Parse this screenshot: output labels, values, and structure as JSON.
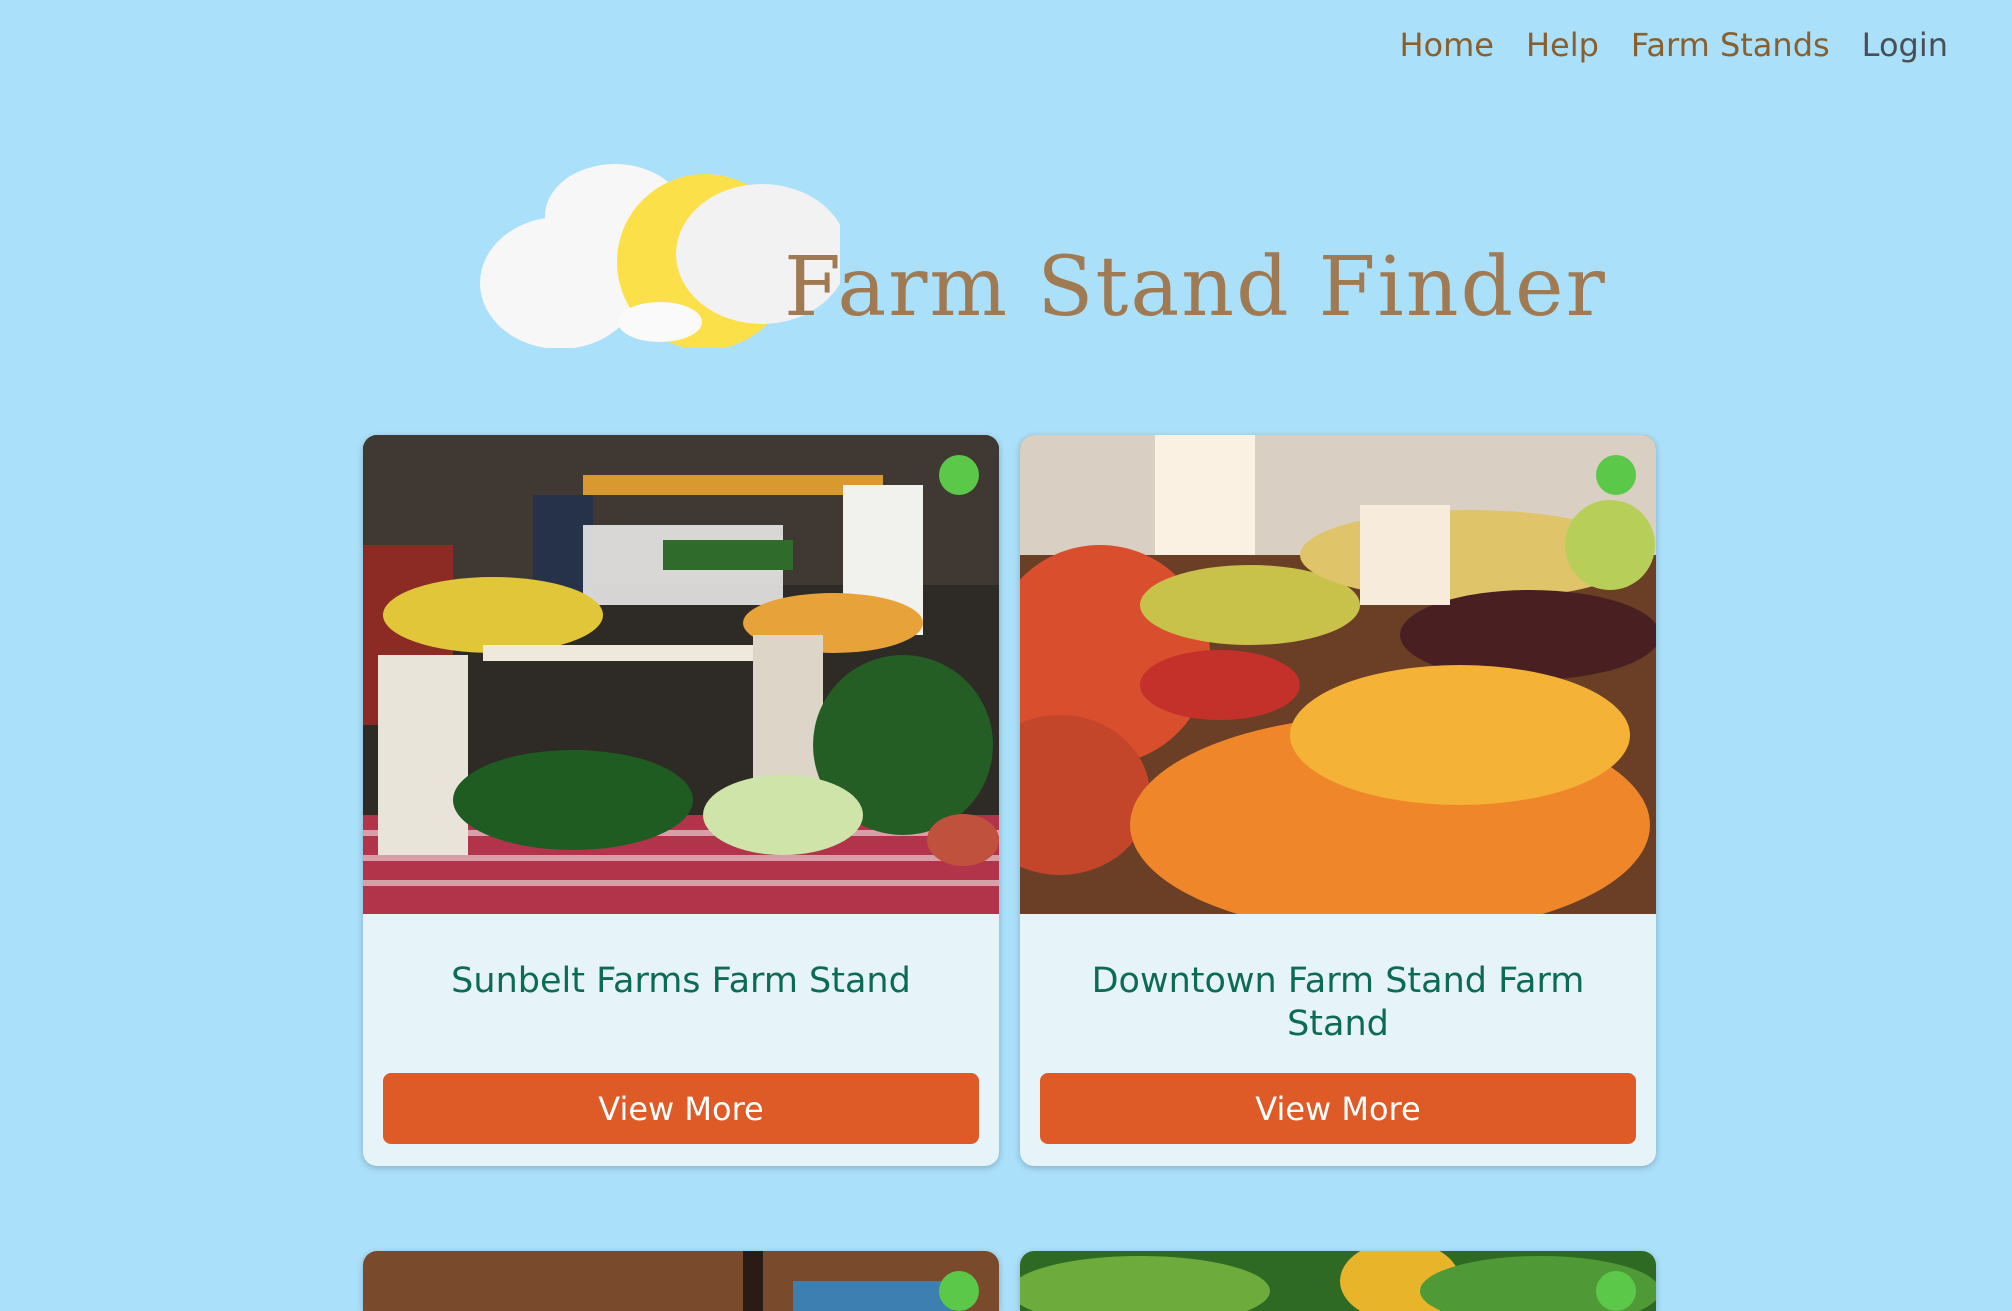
{
  "nav": {
    "items": [
      {
        "label": "Home"
      },
      {
        "label": "Help"
      },
      {
        "label": "Farm Stands"
      },
      {
        "label": "Login"
      }
    ]
  },
  "header": {
    "title": "Farm Stand Finder"
  },
  "cards": [
    {
      "title": "Sunbelt Farms Farm Stand",
      "button": "View More",
      "status": "open"
    },
    {
      "title": "Downtown Farm Stand Farm Stand",
      "button": "View More",
      "status": "open"
    }
  ],
  "colors": {
    "background": "#aae0fa",
    "nav_link": "#8a5f2e",
    "title": "#a07a52",
    "card_title": "#0d6b55",
    "button": "#de5a26",
    "status_open": "#5cc84a"
  }
}
